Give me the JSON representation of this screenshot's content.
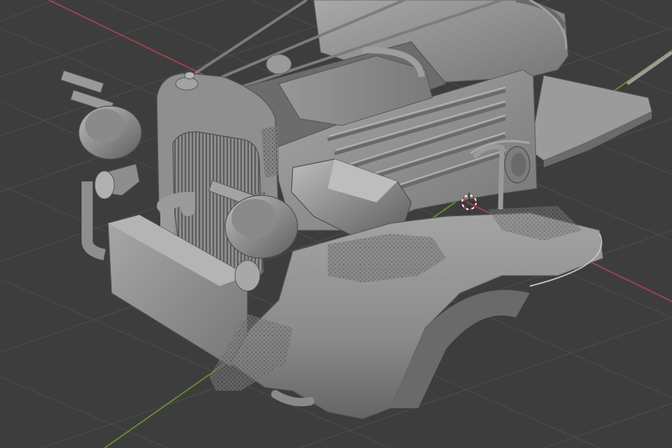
{
  "app": {
    "name": "3D viewport",
    "shading_mode": "solid"
  },
  "viewport": {
    "background_color": "#3d3d3d",
    "grid_line_color": "#4b4b4b",
    "x_axis_color": "#b3434f",
    "y_axis_color": "#6c9a2c",
    "model_base_color": "#8c8c8c",
    "model_shadow_color": "#5e5e5e",
    "model_highlight_color": "#b9b9b9",
    "cursor_colors": [
      "#c83232",
      "#ffffff"
    ]
  },
  "scene": {
    "objects": [
      {
        "name": "vintage-car-front"
      }
    ]
  },
  "icons": {
    "3d-cursor": "3d-cursor-icon"
  }
}
